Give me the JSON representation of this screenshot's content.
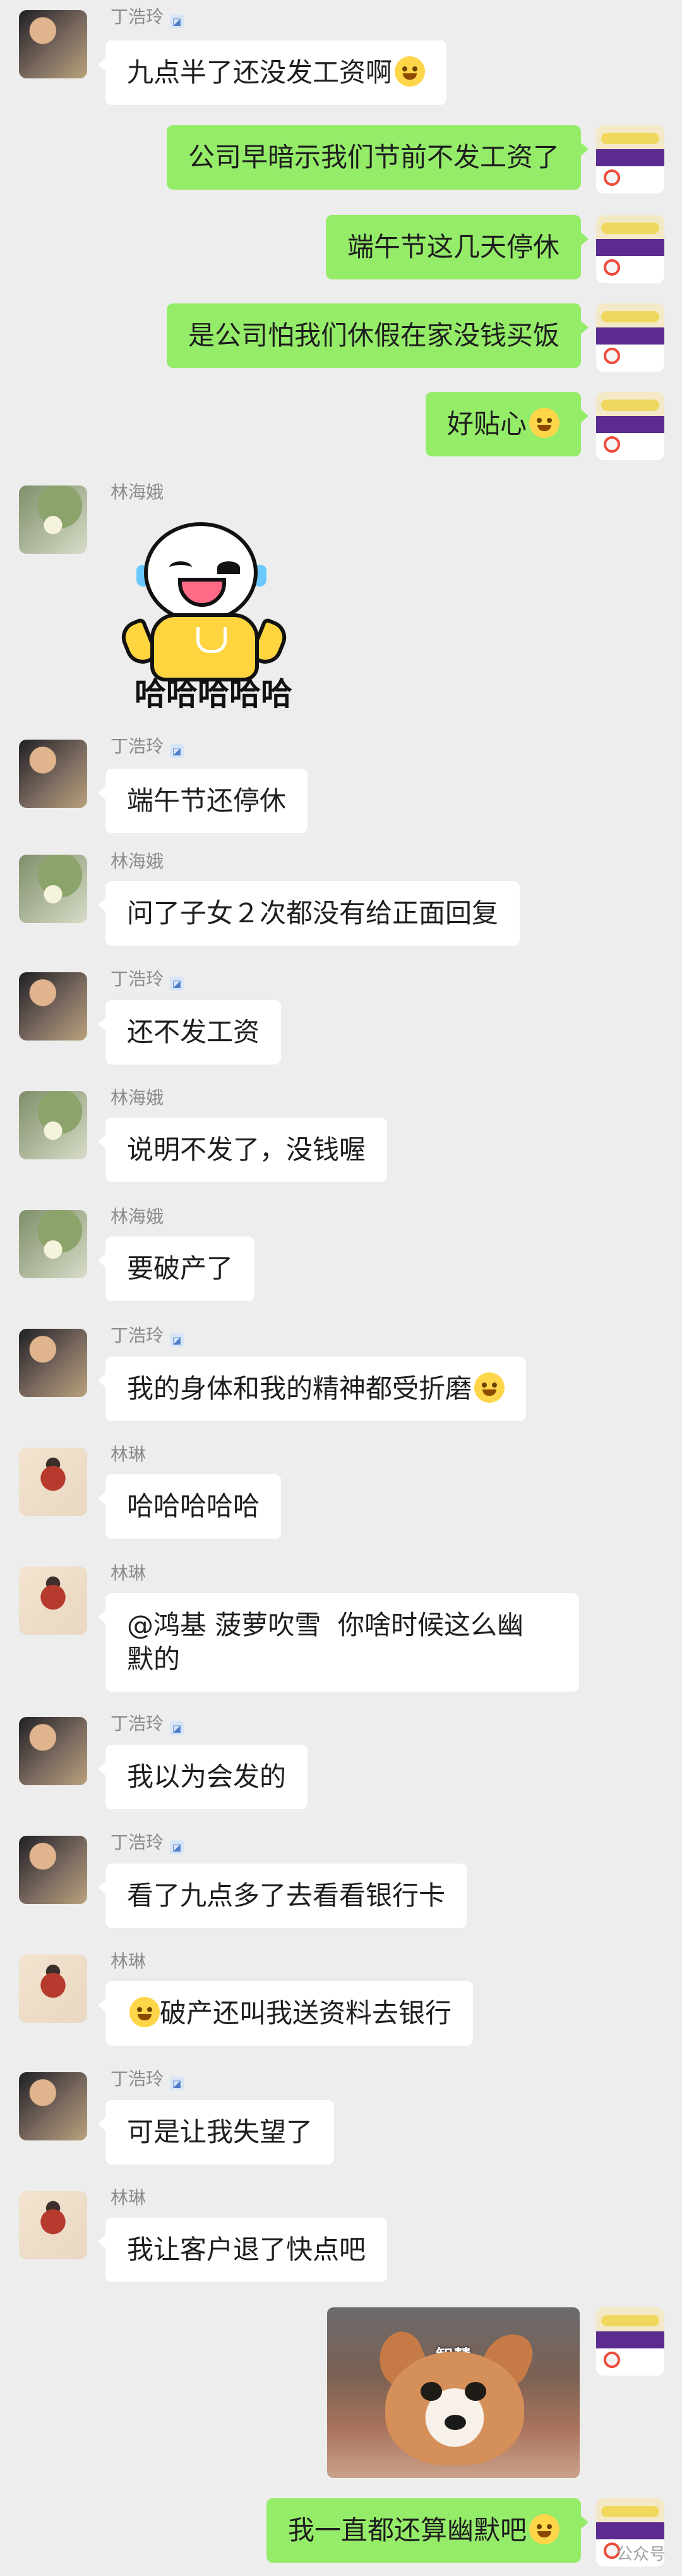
{
  "messages": [
    {
      "speaker": "丁浩玲",
      "text": "九点半了还没发工资啊",
      "emoji": "😂"
    },
    {
      "speaker": "me",
      "text": "公司早暗示我们节前不发工资了"
    },
    {
      "speaker": "me",
      "text": "端午节这几天停休"
    },
    {
      "speaker": "me",
      "text": "是公司怕我们休假在家没钱买饭"
    },
    {
      "speaker": "me",
      "text": "好贴心",
      "emoji": "🥺"
    },
    {
      "speaker": "林海娥",
      "sticker_text": "哈哈哈哈哈"
    },
    {
      "speaker": "丁浩玲",
      "text": "端午节还停休"
    },
    {
      "speaker": "林海娥",
      "text": "问了子女２次都没有给正面回复"
    },
    {
      "speaker": "丁浩玲",
      "text": "还不发工资"
    },
    {
      "speaker": "林海娥",
      "text": "说明不发了，没钱喔"
    },
    {
      "speaker": "林海娥",
      "text": "要破产了"
    },
    {
      "speaker": "丁浩玲",
      "text": "我的身体和我的精神都受折磨",
      "emoji": "😩"
    },
    {
      "speaker": "林琳",
      "text": "哈哈哈哈哈"
    },
    {
      "speaker": "林琳",
      "text": "@鸿基 菠萝吹雪  你啥时候这么幽\n默的"
    },
    {
      "speaker": "丁浩玲",
      "text": "我以为会发的"
    },
    {
      "speaker": "丁浩玲",
      "text": "看了九点多了去看看银行卡"
    },
    {
      "speaker": "林琳",
      "text": "破产还叫我送资料去银行",
      "emoji": "🤔"
    },
    {
      "speaker": "丁浩玲",
      "text": "可是让我失望了"
    },
    {
      "speaker": "林琳",
      "text": "我让客户退了快点吧"
    },
    {
      "speaker": "me",
      "image_caption": "智慧"
    },
    {
      "speaker": "me",
      "text": "我一直都还算幽默吧",
      "emoji": "🥺"
    }
  ],
  "watermark": "公众号"
}
